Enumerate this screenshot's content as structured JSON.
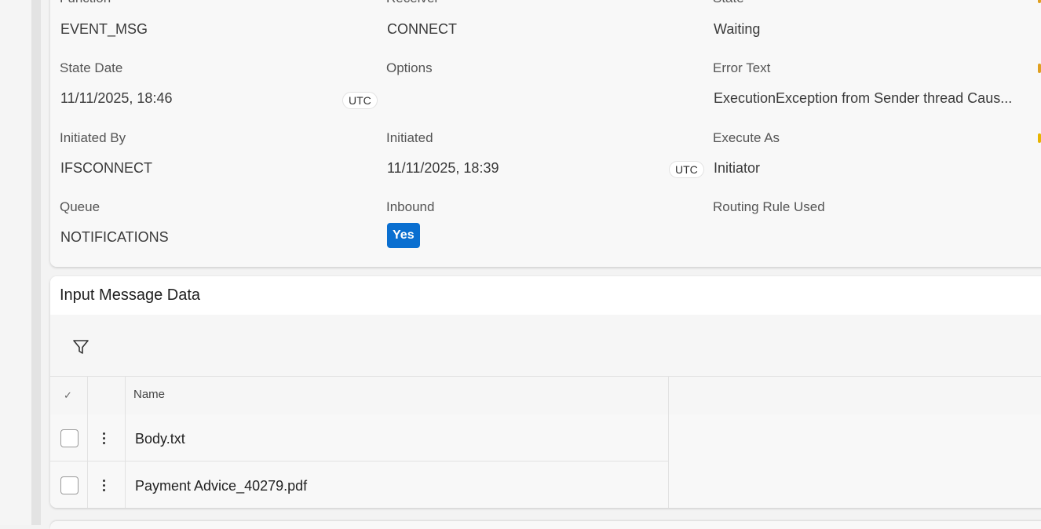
{
  "details": {
    "function_label": "Function",
    "function_value": "EVENT_MSG",
    "receiver_label": "Receiver",
    "receiver_value": "CONNECT",
    "state_label": "State",
    "state_value": "Waiting",
    "state_date_label": "State Date",
    "state_date_value": "11/11/2025, 18:46",
    "state_date_tz": "UTC",
    "options_label": "Options",
    "options_value": "",
    "error_text_label": "Error Text",
    "error_text_value": "ExecutionException from Sender thread Caus...",
    "initiated_by_label": "Initiated By",
    "initiated_by_value": "IFSCONNECT",
    "initiated_label": "Initiated",
    "initiated_value": "11/11/2025, 18:39",
    "initiated_tz": "UTC",
    "execute_as_label": "Execute As",
    "execute_as_value": "Initiator",
    "queue_label": "Queue",
    "queue_value": "NOTIFICATIONS",
    "inbound_label": "Inbound",
    "inbound_value": "Yes",
    "routing_rule_label": "Routing Rule Used",
    "routing_rule_value": ""
  },
  "colors": {
    "accent_blue": "#0a6fd0",
    "edge_mark_orange": "#e0a020",
    "edge_mark_yellow": "#e8b400"
  },
  "input_message_data": {
    "title": "Input Message Data",
    "toolbar_icon": "filter-icon",
    "columns": {
      "select_glyph": "✓",
      "name": "Name"
    },
    "rows": [
      {
        "name": "Body.txt"
      },
      {
        "name": "Payment Advice_40279.pdf"
      }
    ]
  }
}
